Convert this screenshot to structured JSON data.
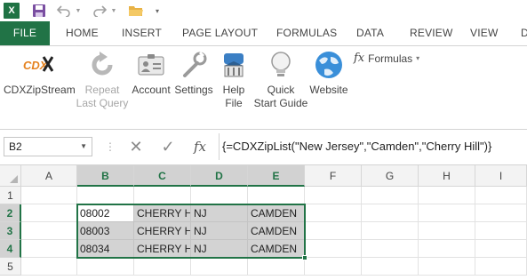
{
  "qat": {
    "excel_letter": "X",
    "more": "▾"
  },
  "tabs": [
    "FILE",
    "HOME",
    "INSERT",
    "PAGE LAYOUT",
    "FORMULAS",
    "DATA",
    "REVIEW",
    "VIEW",
    "D"
  ],
  "ribbon": {
    "cdx_logo": "CDX",
    "cdx_label": "CDXZipStream",
    "repeat_line1": "Repeat",
    "repeat_line2": "Last Query",
    "account": "Account",
    "settings": "Settings",
    "help_line1": "Help",
    "help_line2": "File",
    "quick_line1": "Quick",
    "quick_line2": "Start Guide",
    "website": "Website",
    "formulas_fx": "fx",
    "formulas_label": "Formulas",
    "formulas_caret": "▾"
  },
  "formula_bar": {
    "name_box": "B2",
    "name_caret": "▼",
    "cancel": "✕",
    "enter": "✓",
    "fx": "fx",
    "formula": "{=CDXZipList(\"New Jersey\",\"Camden\",\"Cherry Hill\")}"
  },
  "columns": [
    "A",
    "B",
    "C",
    "D",
    "E",
    "F",
    "G",
    "H",
    "I"
  ],
  "rows": [
    "1",
    "2",
    "3",
    "4",
    "5"
  ],
  "cells": {
    "r2": [
      "08002",
      "CHERRY HILL",
      "NJ",
      "CAMDEN"
    ],
    "r3": [
      "08003",
      "CHERRY HILL",
      "NJ",
      "CAMDEN"
    ],
    "r4": [
      "08034",
      "CHERRY HILL",
      "NJ",
      "CAMDEN"
    ]
  },
  "selection": {
    "range": "B2:E4",
    "active_cell": "B2"
  },
  "colors": {
    "accent": "#217346",
    "selected_fill": "#d3d3d3",
    "header_fill": "#f3f3f3"
  }
}
